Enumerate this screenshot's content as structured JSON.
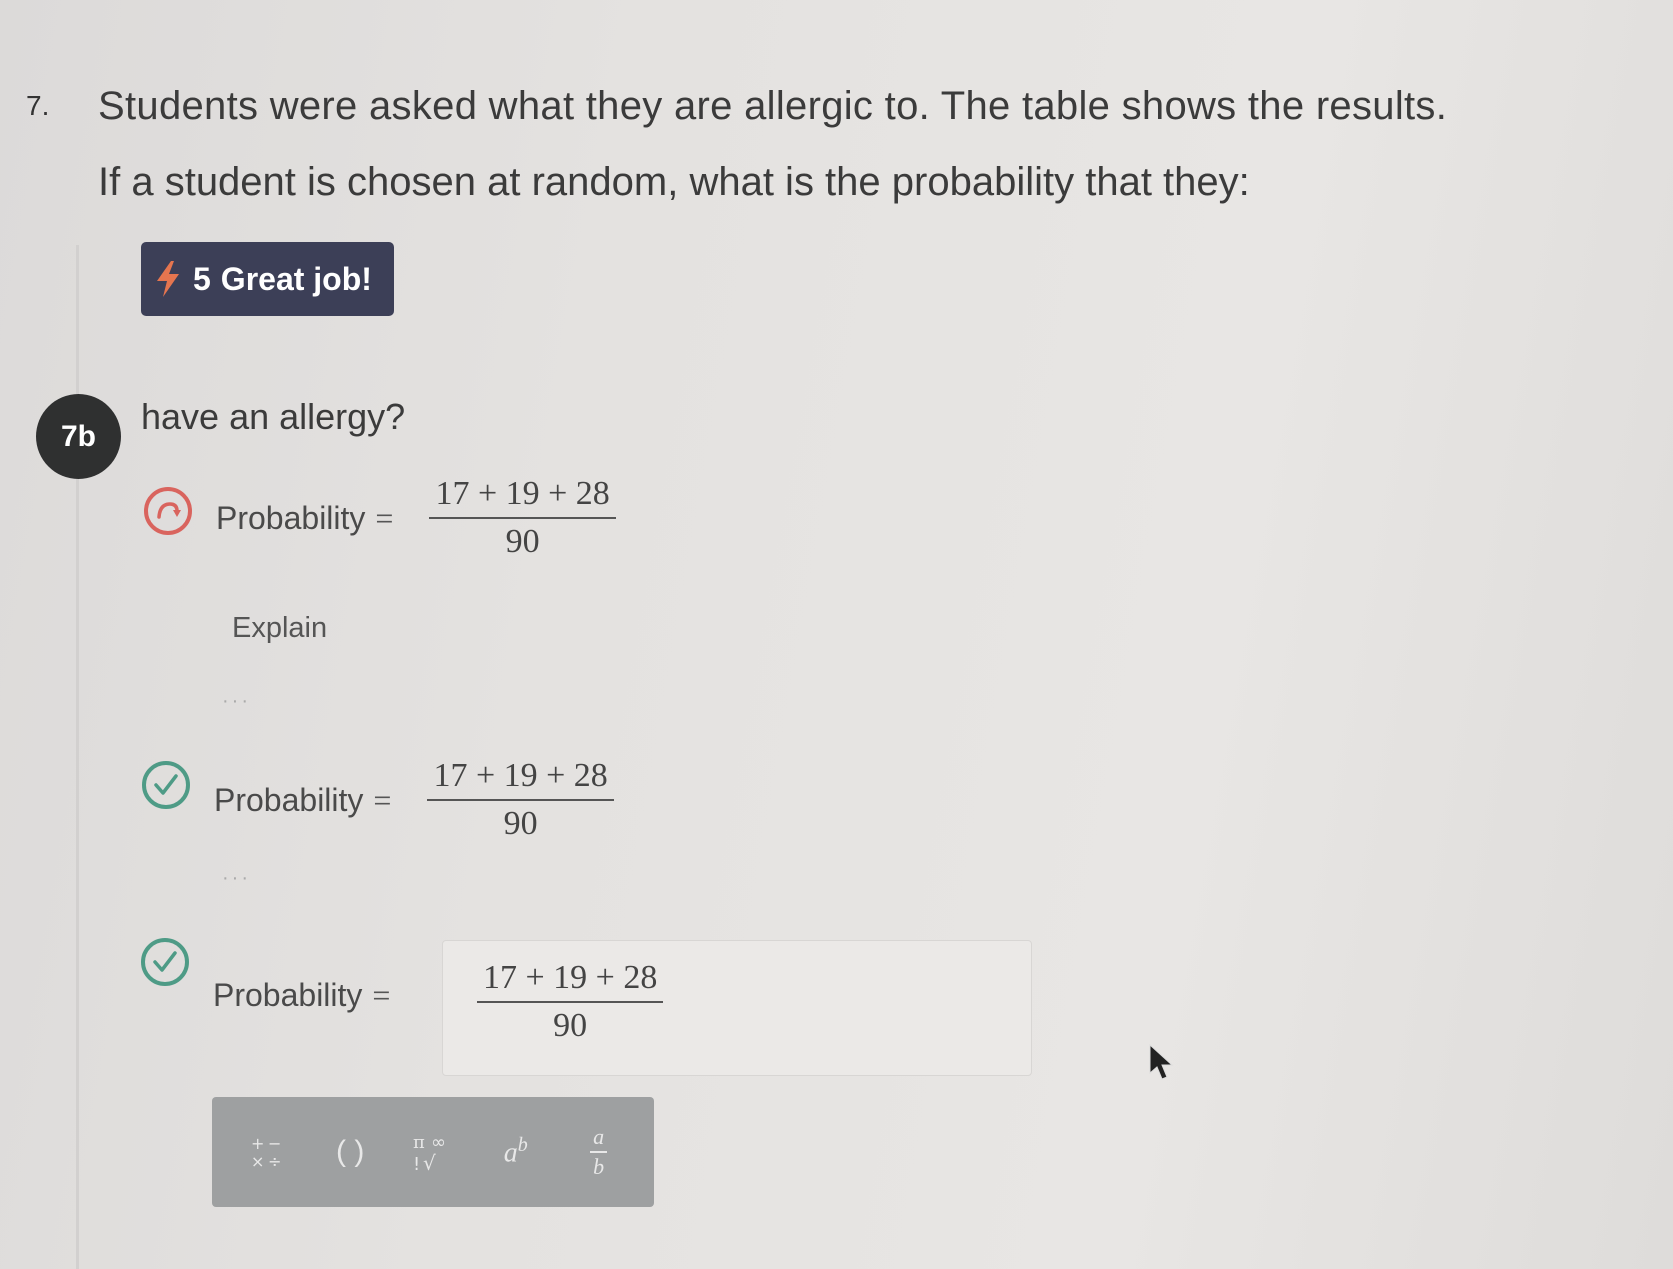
{
  "question": {
    "number": "7.",
    "line1": "Students were asked what they are allergic to. The table shows the results.",
    "line2": "If a student is chosen at random, what is the probability that they:"
  },
  "streak_badge": {
    "count": "5",
    "text": "Great job!"
  },
  "part": {
    "label": "7b",
    "prompt": "have an allergy?"
  },
  "attempts": [
    {
      "status": "incorrect",
      "label": "Probability",
      "equals": "=",
      "numerator": "17 + 19 + 28",
      "denominator": "90",
      "extra": "Explain",
      "dots": "···"
    },
    {
      "status": "correct",
      "label": "Probability",
      "equals": "=",
      "numerator": "17 + 19 + 28",
      "denominator": "90",
      "dots": "···"
    },
    {
      "status": "correct",
      "label": "Probability",
      "equals": "=",
      "numerator": "17 + 19 + 28",
      "denominator": "90"
    }
  ],
  "toolbar": {
    "tools": [
      "operators",
      "brackets",
      "symbols",
      "exponent",
      "fraction"
    ],
    "brackets_label": "( )",
    "fraction_num": "a",
    "fraction_den": "b",
    "exponent_base": "a",
    "exponent_power": "b"
  },
  "colors": {
    "badge_bg": "#3c3f57",
    "bolt": "#e5754f",
    "incorrect": "#d9645e",
    "correct": "#4e9b86",
    "toolbar_bg": "#9ea0a1"
  }
}
